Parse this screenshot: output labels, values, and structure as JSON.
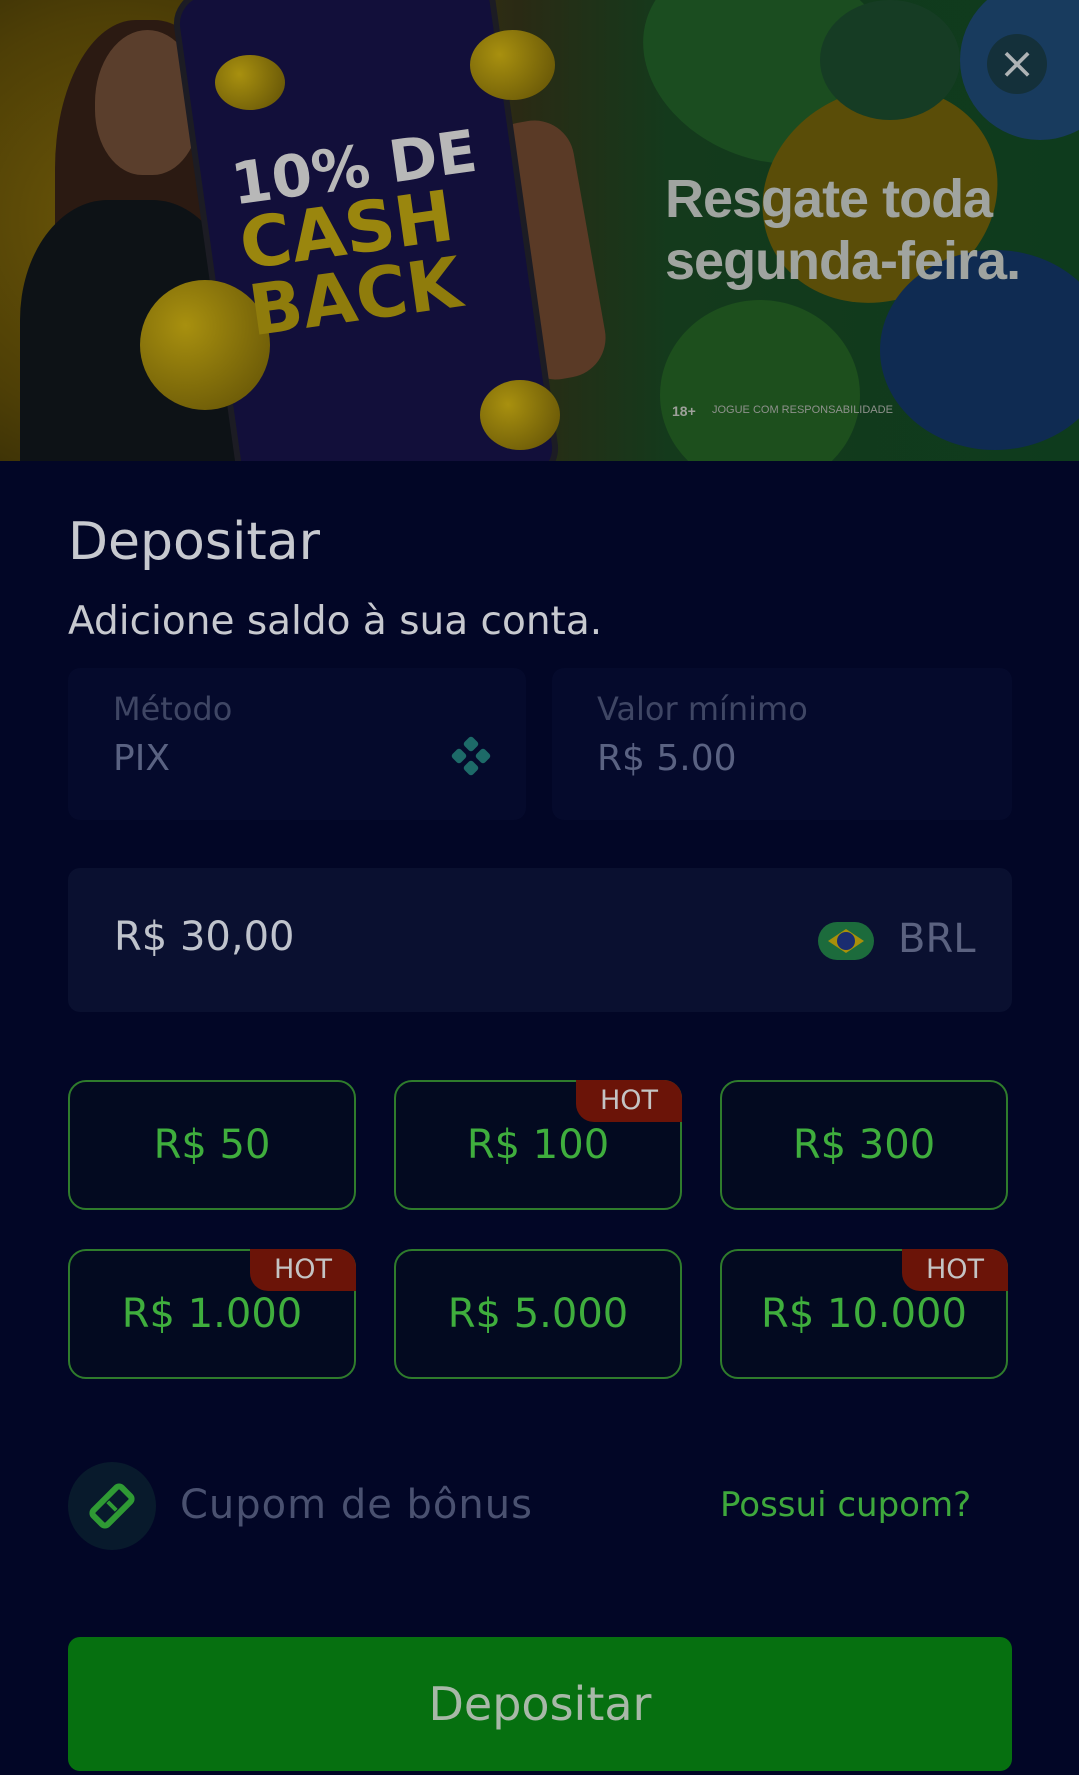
{
  "banner": {
    "promo_line1": "10% DE",
    "promo_line2": "CASH",
    "promo_line3": "BACK",
    "tagline": "Resgate toda segunda-feira.",
    "age_badge": "18+",
    "responsible_gaming": "JOGUE COM RESPONSABILIDADE",
    "close_icon": "close-icon"
  },
  "header": {
    "title": "Depositar",
    "subtitle": "Adicione saldo à sua conta."
  },
  "method": {
    "label": "Método",
    "value": "PIX",
    "icon": "pix-icon"
  },
  "minimum": {
    "label": "Valor mínimo",
    "value": "R$ 5.00"
  },
  "amount": {
    "value": "R$ 30,00",
    "currency": "BRL",
    "flag_icon": "brazil-flag-icon"
  },
  "quick_amounts": [
    {
      "label": "R$ 50",
      "hot": ""
    },
    {
      "label": "R$ 100",
      "hot": "HOT"
    },
    {
      "label": "R$ 300",
      "hot": ""
    },
    {
      "label": "R$ 1.000",
      "hot": "HOT"
    },
    {
      "label": "R$ 5.000",
      "hot": ""
    },
    {
      "label": "R$ 10.000",
      "hot": "HOT"
    }
  ],
  "coupon": {
    "label": "Cupom de bônus",
    "link": "Possui cupom?",
    "icon": "ticket-icon"
  },
  "submit_label": "Depositar",
  "colors": {
    "background": "#020626",
    "accent_green": "#3fae3d",
    "button_green": "#067010",
    "hot_badge": "#6b1408"
  }
}
